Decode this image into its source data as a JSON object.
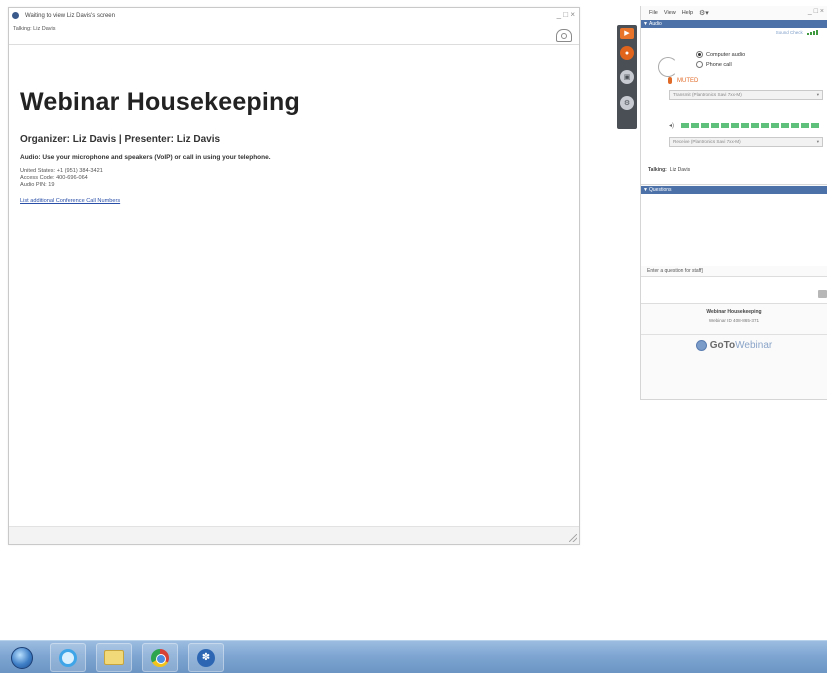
{
  "viewer": {
    "title": "Waiting to view Liz Davis's screen",
    "talking": "Talking: Liz Davis",
    "controls": "_ □ ×",
    "content": {
      "heading": "Webinar Housekeeping",
      "organizer_line": "Organizer: Liz Davis  |  Presenter: Liz Davis",
      "audio_instruction": "Audio: Use your microphone and speakers (VoIP) or call in using your telephone.",
      "phone_line": "United States: +1 (951) 384-3421",
      "access_code_line": "Access Code: 400-696-064",
      "audio_pin_line": "Audio PIN: 19",
      "link_text": "List additional Conference Call Numbers"
    }
  },
  "panel": {
    "menu": [
      "File",
      "View",
      "Help"
    ],
    "controls": "_ □ ×",
    "audio": {
      "header": "Audio",
      "sound_check": "Sound Check",
      "option_computer": "Computer audio",
      "option_phone": "Phone call",
      "mic_status": "MUTED",
      "mic_device": "Transmit (Plantronics Savi 7xx-M)",
      "speaker_device": "Receive (Plantronics Savi 7xx-M)",
      "talking_label": "Talking:",
      "talking_name": "Liz Davis"
    },
    "questions": {
      "header": "Questions",
      "prompt": "Enter a question for staff]"
    },
    "webinar": {
      "title": "Webinar Housekeeping",
      "id": "Webinar ID 408-865-371"
    },
    "brand": {
      "part1": "GoTo",
      "part2": "Webinar"
    }
  },
  "colors": {
    "pane_header": "#4b71a8",
    "muted_orange": "#e06a28",
    "level_green": "#5ec07a",
    "taskbar": "#7fa6d2"
  },
  "icons": {
    "strip": [
      "webcam-icon",
      "mic-icon",
      "screen-share-icon",
      "settings-icon"
    ],
    "taskbar": [
      "start-orb-icon",
      "internet-explorer-icon",
      "file-explorer-icon",
      "chrome-icon",
      "gotowebinar-icon"
    ]
  }
}
